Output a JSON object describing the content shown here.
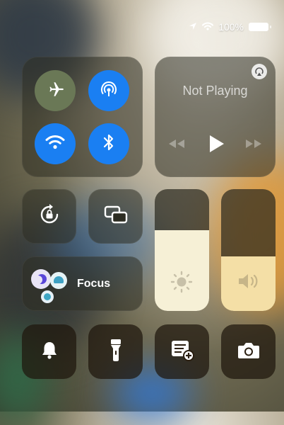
{
  "status_bar": {
    "battery_text": "100%",
    "location_icon": "location-arrow-icon",
    "wifi_icon": "wifi-icon",
    "battery_level": 1.0
  },
  "connectivity": {
    "airplane": {
      "icon": "airplane-icon",
      "active": false
    },
    "cellular": {
      "icon": "cellular-icon",
      "active": true
    },
    "wifi": {
      "icon": "wifi-icon",
      "active": true
    },
    "bluetooth": {
      "icon": "bluetooth-icon",
      "active": true
    }
  },
  "media": {
    "title": "Not Playing",
    "airplay_icon": "airplay-icon"
  },
  "toggles": {
    "rotation_lock_icon": "rotation-lock-icon",
    "screen_mirroring_icon": "screen-mirroring-icon"
  },
  "focus": {
    "label": "Focus"
  },
  "sliders": {
    "brightness": {
      "level": 0.66,
      "icon": "sun-icon"
    },
    "volume": {
      "level": 0.45,
      "icon": "speaker-icon"
    }
  },
  "buttons": [
    {
      "name": "alarm-bell-icon"
    },
    {
      "name": "flashlight-icon"
    },
    {
      "name": "quick-note-icon"
    },
    {
      "name": "camera-icon"
    }
  ]
}
